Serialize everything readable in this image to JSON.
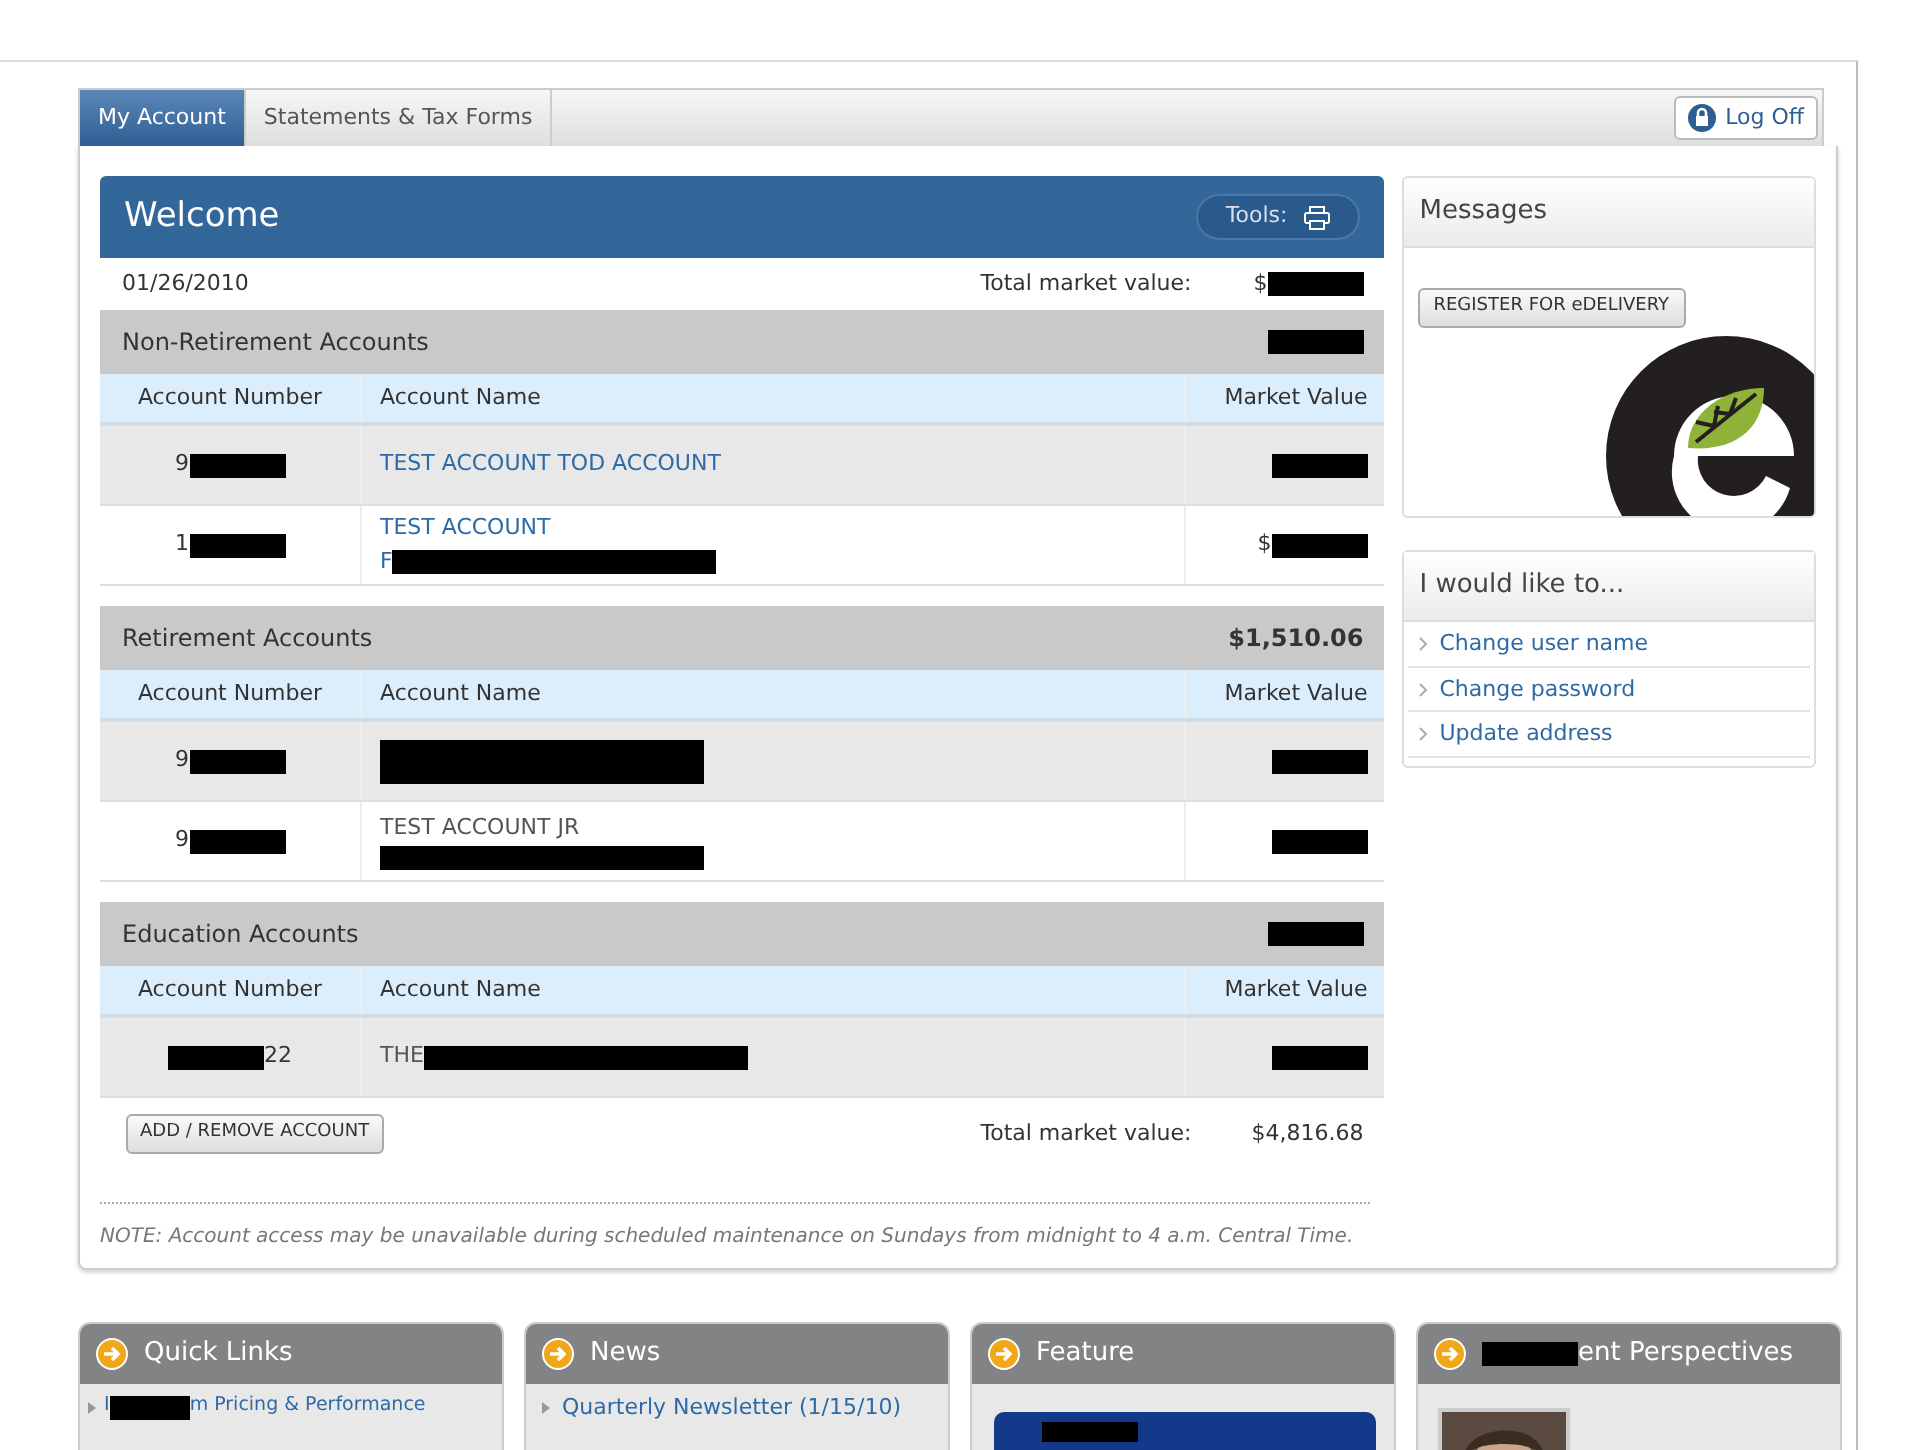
{
  "tabs": [
    {
      "label": "My Account",
      "selected": true
    },
    {
      "label": "Statements & Tax Forms",
      "selected": false
    }
  ],
  "log_off": "Log Off",
  "welcome": {
    "title": "Welcome",
    "tools": "Tools:",
    "date": "01/26/2010",
    "total_label": "Total market value:",
    "total_value": [
      {
        "kind": "text",
        "text": "$"
      },
      {
        "kind": "redaction"
      }
    ]
  },
  "sections": [
    {
      "title": "Non-Retirement Accounts",
      "total": [
        {
          "kind": "redaction"
        }
      ],
      "columns": [
        "Account Number",
        "Account Name",
        "Market Value"
      ],
      "rows": [
        {
          "number": [
            {
              "kind": "text",
              "text": "9"
            },
            {
              "kind": "redaction"
            }
          ],
          "link": true,
          "name_lines": [
            [
              {
                "kind": "text",
                "text": "TEST ACCOUNT TOD ACCOUNT"
              }
            ]
          ],
          "value": [
            {
              "kind": "redaction"
            }
          ]
        },
        {
          "number": [
            {
              "kind": "text",
              "text": "1"
            },
            {
              "kind": "redaction"
            }
          ],
          "link": true,
          "name_lines": [
            [
              {
                "kind": "text",
                "text": "TEST ACCOUNT"
              }
            ],
            [
              {
                "kind": "text",
                "text": "F"
              },
              {
                "kind": "long-redaction"
              }
            ]
          ],
          "value": [
            {
              "kind": "text",
              "text": "$"
            },
            {
              "kind": "redaction"
            }
          ]
        }
      ]
    },
    {
      "title": "Retirement Accounts",
      "total": [
        {
          "kind": "text",
          "text": "$1,510.06"
        }
      ],
      "columns": [
        "Account Number",
        "Account Name",
        "Market Value"
      ],
      "rows": [
        {
          "number": [
            {
              "kind": "text",
              "text": "9"
            },
            {
              "kind": "redaction"
            }
          ],
          "name_lines": [
            [
              {
                "kind": "tall-redaction"
              }
            ]
          ],
          "value": [
            {
              "kind": "redaction"
            }
          ]
        },
        {
          "number": [
            {
              "kind": "text",
              "text": "9"
            },
            {
              "kind": "redaction"
            }
          ],
          "link": false,
          "name_lines": [
            [
              {
                "kind": "text",
                "text": "TEST ACCOUNT JR"
              }
            ],
            [
              {
                "kind": "long-redaction"
              }
            ]
          ],
          "value": [
            {
              "kind": "redaction"
            }
          ]
        }
      ]
    },
    {
      "title": "Education Accounts",
      "total": [
        {
          "kind": "redaction"
        }
      ],
      "columns": [
        "Account Number",
        "Account Name",
        "Market Value"
      ],
      "rows": [
        {
          "number": [
            {
              "kind": "redaction"
            },
            {
              "kind": "text",
              "text": "22"
            }
          ],
          "link": false,
          "name_lines": [
            [
              {
                "kind": "text",
                "text": "THE"
              },
              {
                "kind": "long-redaction"
              }
            ]
          ],
          "value": [
            {
              "kind": "redaction"
            }
          ]
        }
      ]
    }
  ],
  "add_button": "ADD / REMOVE ACCOUNT",
  "footer_total_label": "Total market value:",
  "footer_total_value": "$4,816.68",
  "note": "NOTE: Account access may be unavailable during scheduled maintenance on Sundays from midnight to 4 a.m. Central Time.",
  "messages": {
    "title": "Messages",
    "button": "REGISTER FOR eDELIVERY"
  },
  "actions": {
    "title": "I would like to...",
    "items": [
      "Change user name",
      "Change password",
      "Update address"
    ]
  },
  "bottom_panels": [
    {
      "kind": "links",
      "title": [
        {
          "kind": "text",
          "text": "Quick Links"
        }
      ],
      "items": [
        [
          {
            "kind": "text",
            "text": "I"
          },
          {
            "kind": "redaction"
          },
          {
            "kind": "text",
            "text": "m Pricing & Performance"
          }
        ]
      ]
    },
    {
      "kind": "links",
      "title": [
        {
          "kind": "text",
          "text": "News"
        }
      ],
      "items": [
        [
          {
            "kind": "text",
            "text": "Quarterly Newsletter (1/15/10)"
          }
        ]
      ]
    },
    {
      "kind": "feature",
      "title": [
        {
          "kind": "text",
          "text": "Feature"
        }
      ]
    },
    {
      "title": [
        {
          "kind": "redaction"
        },
        {
          "kind": "text",
          "text": "ent Perspectives"
        }
      ]
    }
  ]
}
